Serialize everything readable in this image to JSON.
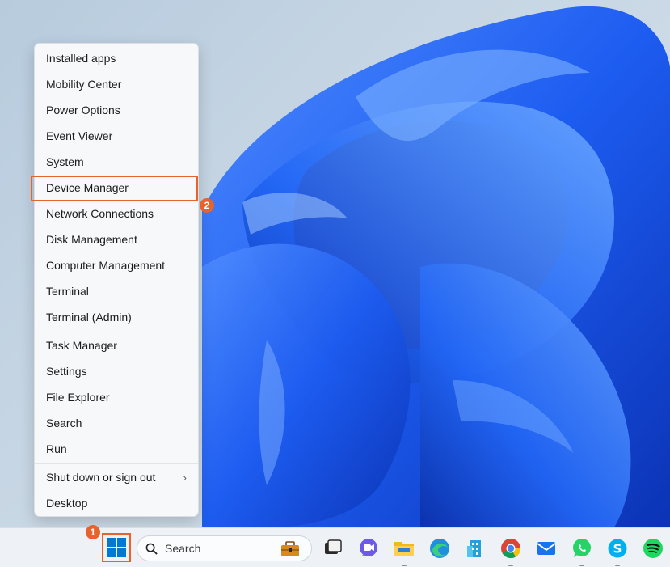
{
  "menu": {
    "items": [
      {
        "label": "Installed apps"
      },
      {
        "label": "Mobility Center"
      },
      {
        "label": "Power Options"
      },
      {
        "label": "Event Viewer"
      },
      {
        "label": "System"
      },
      {
        "label": "Device Manager"
      },
      {
        "label": "Network Connections"
      },
      {
        "label": "Disk Management"
      },
      {
        "label": "Computer Management"
      },
      {
        "label": "Terminal"
      },
      {
        "label": "Terminal (Admin)"
      },
      {
        "label": "Task Manager"
      },
      {
        "label": "Settings"
      },
      {
        "label": "File Explorer"
      },
      {
        "label": "Search"
      },
      {
        "label": "Run"
      },
      {
        "label": "Shut down or sign out"
      },
      {
        "label": "Desktop"
      }
    ],
    "shutdown_chevron": "›"
  },
  "annotations": {
    "step1": "1",
    "step2": "2",
    "highlight_color": "#e8632b"
  },
  "taskbar": {
    "search_placeholder": "Search",
    "icons": [
      "windows-start-icon",
      "search-icon",
      "briefcase-icon",
      "task-view-icon",
      "chat-icon",
      "file-explorer-icon",
      "edge-icon",
      "building-app-icon",
      "chrome-icon",
      "mail-icon",
      "whatsapp-icon",
      "skype-icon",
      "spotify-icon"
    ]
  },
  "colors": {
    "accent": "#0067c0",
    "wallpaper_blue": "#1a5fe0"
  }
}
